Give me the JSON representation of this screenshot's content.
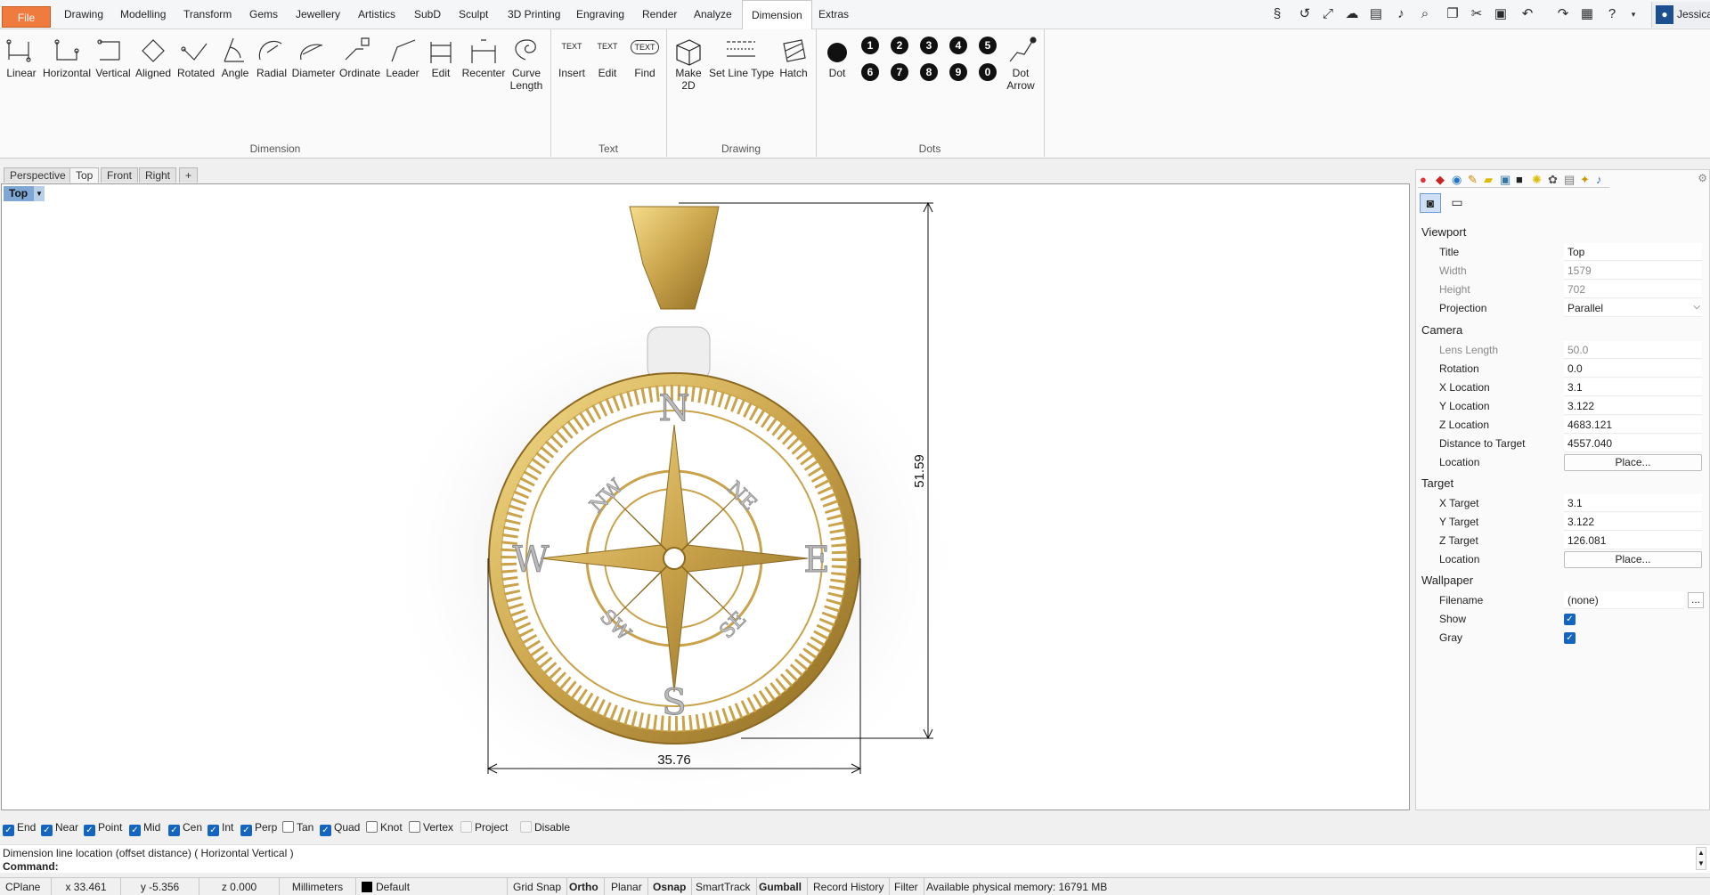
{
  "menu": {
    "file": "File",
    "items": [
      "Drawing",
      "Modelling",
      "Transform",
      "Gems",
      "Jewellery",
      "Artistics",
      "SubD",
      "Sculpt",
      "3D Printing",
      "Engraving",
      "Render",
      "Analyze",
      "Dimension",
      "Extras"
    ],
    "active": "Dimension"
  },
  "user": {
    "name": "Jessica"
  },
  "ribbon": {
    "dimension_tools": [
      "Linear",
      "Horizontal",
      "Vertical",
      "Aligned",
      "Rotated",
      "Angle",
      "Radial",
      "Diameter",
      "Ordinate",
      "Leader",
      "Edit",
      "Recenter"
    ],
    "curve_length_1": "Curve",
    "curve_length_2": "Length",
    "text_tools": [
      "Insert",
      "Edit",
      "Find"
    ],
    "text_icon_label": "TEXT",
    "make2d_1": "Make",
    "make2d_2": "2D",
    "set_line_type": "Set Line Type",
    "hatch": "Hatch",
    "dot": "Dot",
    "dot_numbers": [
      "1",
      "2",
      "3",
      "4",
      "5",
      "6",
      "7",
      "8",
      "9",
      "0"
    ],
    "dot_arrow_1": "Dot",
    "dot_arrow_2": "Arrow",
    "groups": {
      "dimension": "Dimension",
      "text": "Text",
      "drawing": "Drawing",
      "dots": "Dots"
    }
  },
  "viewport_tabs": [
    "Perspective",
    "Top",
    "Front",
    "Right"
  ],
  "viewport_tab_add": "+",
  "viewport": {
    "label": "Top",
    "dim_vertical": "51.59",
    "dim_horizontal": "35.76",
    "compass": {
      "n": "N",
      "s": "S",
      "e": "E",
      "w": "W",
      "ne": "NE",
      "nw": "NW",
      "se": "SE",
      "sw": "SW"
    }
  },
  "properties": {
    "viewport_section": "Viewport",
    "title_k": "Title",
    "title_v": "Top",
    "width_k": "Width",
    "width_v": "1579",
    "height_k": "Height",
    "height_v": "702",
    "projection_k": "Projection",
    "projection_v": "Parallel",
    "camera_section": "Camera",
    "lens_k": "Lens Length",
    "lens_v": "50.0",
    "rotation_k": "Rotation",
    "rotation_v": "0.0",
    "xloc_k": "X Location",
    "xloc_v": "3.1",
    "yloc_k": "Y Location",
    "yloc_v": "3.122",
    "zloc_k": "Z Location",
    "zloc_v": "4683.121",
    "dist_k": "Distance to Target",
    "dist_v": "4557.040",
    "location_k": "Location",
    "place_label": "Place...",
    "target_section": "Target",
    "xt_k": "X Target",
    "xt_v": "3.1",
    "yt_k": "Y Target",
    "yt_v": "3.122",
    "zt_k": "Z Target",
    "zt_v": "126.081",
    "wallpaper_section": "Wallpaper",
    "filename_k": "Filename",
    "filename_v": "(none)",
    "browse_label": "...",
    "show_k": "Show",
    "show_v": true,
    "gray_k": "Gray",
    "gray_v": true
  },
  "osnaps": [
    {
      "label": "End",
      "state": "on"
    },
    {
      "label": "Near",
      "state": "on"
    },
    {
      "label": "Point",
      "state": "on"
    },
    {
      "label": "Mid",
      "state": "on"
    },
    {
      "label": "Cen",
      "state": "on"
    },
    {
      "label": "Int",
      "state": "on"
    },
    {
      "label": "Perp",
      "state": "on"
    },
    {
      "label": "Tan",
      "state": "off"
    },
    {
      "label": "Quad",
      "state": "on"
    },
    {
      "label": "Knot",
      "state": "off"
    },
    {
      "label": "Vertex",
      "state": "off"
    },
    {
      "label": "Project",
      "state": "disabled"
    },
    {
      "label": "Disable",
      "state": "disabled"
    }
  ],
  "command": {
    "prompt_history": "Dimension line location (offset distance) ( Horizontal  Vertical )",
    "prompt": "Command:"
  },
  "status": {
    "cplane": "CPlane",
    "x": "x 33.461",
    "y": "y -5.356",
    "z": "z 0.000",
    "units": "Millimeters",
    "layer": "Default",
    "grid_snap": "Grid Snap",
    "ortho": "Ortho",
    "planar": "Planar",
    "osnap": "Osnap",
    "smarttrack": "SmartTrack",
    "gumball": "Gumball",
    "record_history": "Record History",
    "filter": "Filter",
    "memory": "Available physical memory: 16791 MB"
  },
  "colors": {
    "accent": "#1565c0",
    "file_tab": "#ef7b3e",
    "gold": "#c9a24a",
    "viewport_label": "#7fa7d6"
  }
}
